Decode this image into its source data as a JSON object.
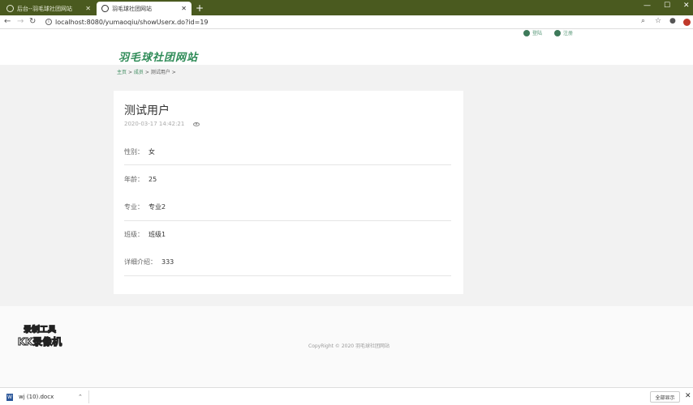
{
  "browser": {
    "tabs": [
      {
        "title": "后台--羽毛球社团网站",
        "close": "✕"
      },
      {
        "title": "羽毛球社团网站",
        "close": "✕"
      }
    ],
    "new_tab": "+",
    "window_controls": {
      "minimize": "—",
      "maximize": "☐",
      "close": "✕"
    },
    "nav": {
      "back": "←",
      "forward": "→",
      "reload": "↻"
    },
    "url": "localhost:8080/yumaoqiu/showUserx.do?id=19",
    "info_icon": "i",
    "icons": {
      "zoom": "search-icon",
      "star": "star-icon",
      "profile": "profile-icon",
      "extension": "extension-icon"
    }
  },
  "header": {
    "logo": "羽毛球社团网站",
    "links": [
      {
        "label": "登陆",
        "icon": "user-icon"
      },
      {
        "label": "注册",
        "icon": "register-icon"
      }
    ]
  },
  "breadcrumb": {
    "home": "主页",
    "sep": ">",
    "members": "成员",
    "current": "测试用户"
  },
  "card": {
    "title": "测试用户",
    "timestamp": "2020-03-17 14:42:21",
    "fields": [
      {
        "label": "性别：",
        "value": "女"
      },
      {
        "label": "年龄：",
        "value": "25"
      },
      {
        "label": "专业：",
        "value": "专业2"
      },
      {
        "label": "班级：",
        "value": "班级1"
      },
      {
        "label": "详细介绍：",
        "value": "333"
      }
    ]
  },
  "footer": {
    "copyright": "CopyRight © 2020 羽毛球社团网站",
    "watermark_line1": "录制工具",
    "watermark_line2": "KK录像机"
  },
  "downloads": {
    "file": "wj (10).docx",
    "file_icon": "W",
    "chevron": "⌃",
    "show_all": "全部显示",
    "close": "✕"
  },
  "colors": {
    "tabstrip": "#4a5a1f",
    "brand_green": "#2e8b57",
    "link_green": "#3b8a5d"
  }
}
